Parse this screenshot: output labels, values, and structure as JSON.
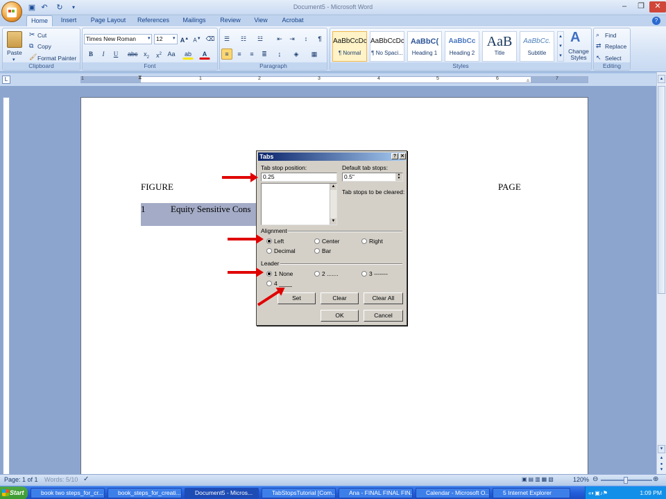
{
  "window": {
    "title": "Document5 - Microsoft Word"
  },
  "tabs": [
    "Home",
    "Insert",
    "Page Layout",
    "References",
    "Mailings",
    "Review",
    "View",
    "Acrobat"
  ],
  "clipboard": {
    "paste": "Paste",
    "cut": "Cut",
    "copy": "Copy",
    "format_painter": "Format Painter",
    "label": "Clipboard"
  },
  "font": {
    "name": "Times New Roman",
    "size": "12",
    "label": "Font"
  },
  "paragraph": {
    "label": "Paragraph"
  },
  "styles": {
    "items": [
      {
        "preview": "AaBbCcDc",
        "name": "¶ Normal"
      },
      {
        "preview": "AaBbCcDc",
        "name": "¶ No Spaci..."
      },
      {
        "preview": "AaBbC(",
        "name": "Heading 1"
      },
      {
        "preview": "AaBbCc",
        "name": "Heading 2"
      },
      {
        "preview": "AaB",
        "name": "Title"
      },
      {
        "preview": "AaBbCc.",
        "name": "Subtitle"
      }
    ],
    "change_styles": "Change Styles",
    "label": "Styles"
  },
  "editing": {
    "find": "Find",
    "replace": "Replace",
    "select": "Select",
    "label": "Editing"
  },
  "ruler_numbers": [
    "1",
    "1",
    "2",
    "3",
    "4",
    "5",
    "6",
    "7"
  ],
  "document": {
    "col_left": "FIGURE",
    "col_right": "PAGE",
    "row_number": "1",
    "row_text": "Equity Sensitive Cons"
  },
  "dialog": {
    "title": "Tabs",
    "tab_stop_label": "Tab stop position:",
    "tab_stop_value": "0.25",
    "default_label": "Default tab stops:",
    "default_value": "0.5\"",
    "cleared_label": "Tab stops to be cleared:",
    "alignment_label": "Alignment",
    "alignment": {
      "left": "Left",
      "center": "Center",
      "right": "Right",
      "decimal": "Decimal",
      "bar": "Bar"
    },
    "leader_label": "Leader",
    "leader": {
      "none": "1 None",
      "dots": "2 .......",
      "dashes": "3 -------",
      "line": "4 ____"
    },
    "set": "Set",
    "clear": "Clear",
    "clear_all": "Clear All",
    "ok": "OK",
    "cancel": "Cancel"
  },
  "status": {
    "page": "Page: 1 of 1",
    "words": "Words: 5/10",
    "zoom": "120%"
  },
  "taskbar": {
    "start": "Start",
    "items": [
      "book two steps_for_cr...",
      "book_steps_for_creati...",
      "Document5 - Micros...",
      "TabStopsTutorial [Com...",
      "Ana - FINAL FINAL FIN...",
      "Calendar - Microsoft O...",
      "5 Internet Explorer"
    ],
    "time": "1:09 PM"
  },
  "colors": {
    "accent_arrow": "#e00000",
    "dialog_title": "#0a246a",
    "selection": "#a3abc6"
  }
}
